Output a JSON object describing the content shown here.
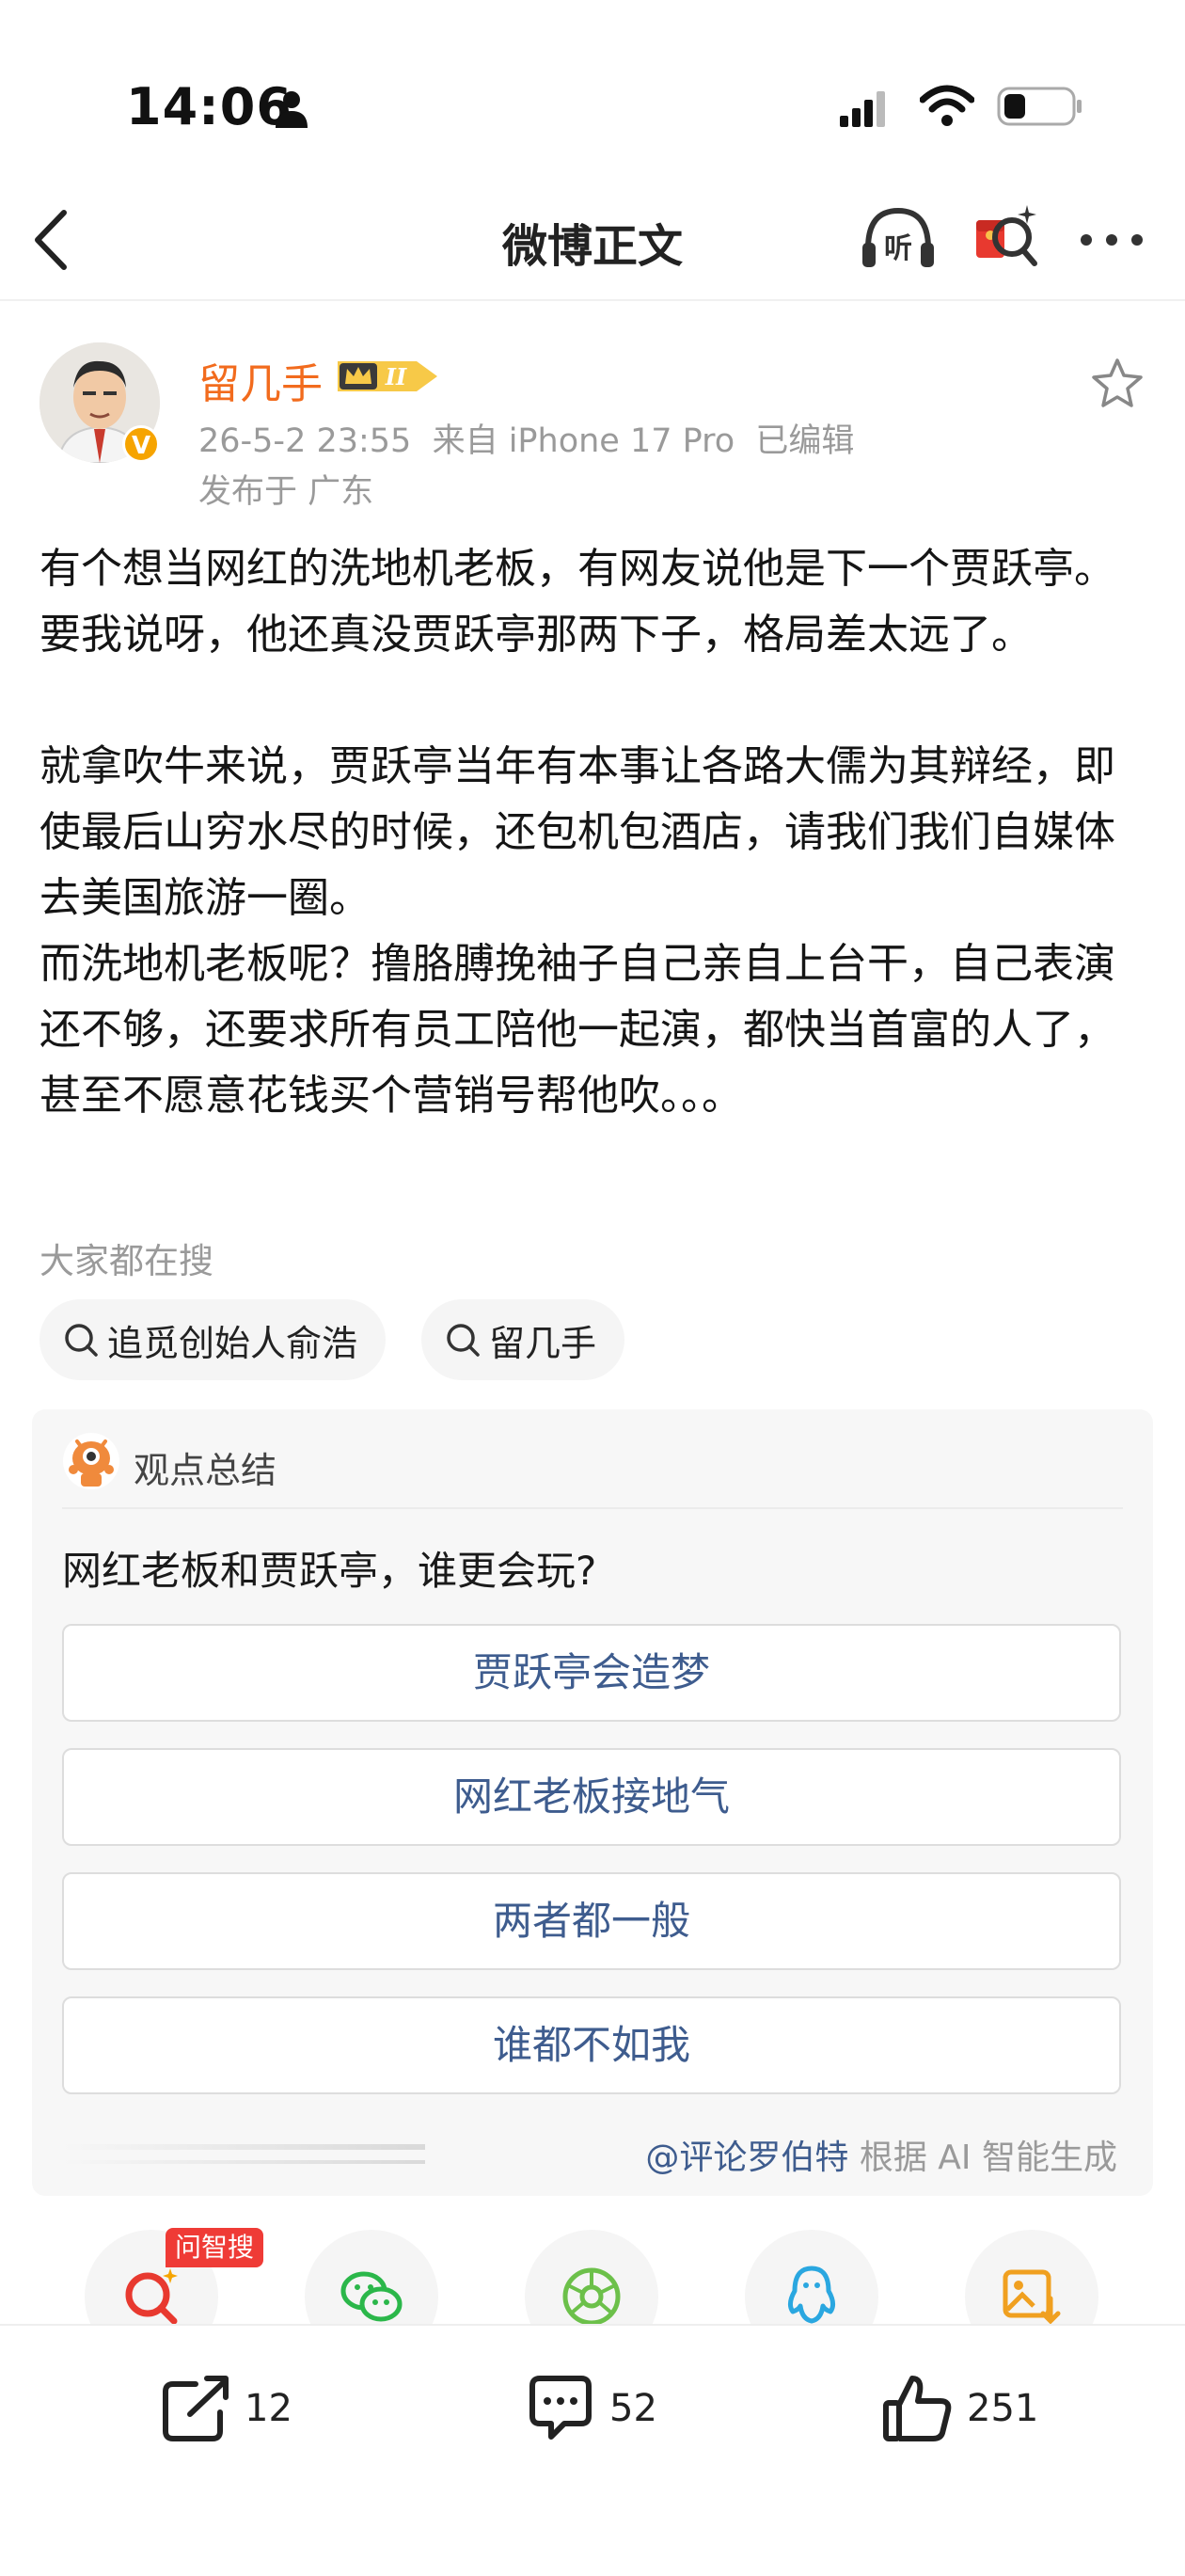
{
  "status_bar": {
    "time": "14:06"
  },
  "nav": {
    "title": "微博正文"
  },
  "author": {
    "name": "留几手",
    "verified_badge": "V",
    "meta_line": "26-5-2 23:55  来自 iPhone 17 Pro  已编辑",
    "location_line": "发布于 广东"
  },
  "post": {
    "text": "有个想当网红的洗地机老板，有网友说他是下一个贾跃亭。\n要我说呀，他还真没贾跃亭那两下子，格局差太远了。\n\n就拿吹牛来说，贾跃亭当年有本事让各路大儒为其辩经，即使最后山穷水尽的时候，还包机包酒店，请我们我们自媒体去美国旅游一圈。\n而洗地机老板呢？撸胳膊挽袖子自己亲自上台干，自己表演还不够，还要求所有员工陪他一起演，都快当首富的人了，甚至不愿意花钱买个营销号帮他吹。。。"
  },
  "hot_search": {
    "label": "大家都在搜",
    "chips": [
      "追觅创始人俞浩",
      "留几手"
    ]
  },
  "summary_card": {
    "header": "观点总结",
    "question": "网红老板和贾跃亭，谁更会玩?",
    "options": [
      "贾跃亭会造梦",
      "网红老板接地气",
      "两者都一般",
      "谁都不如我"
    ],
    "credit_handle": "@评论罗伯特",
    "credit_note": " 根据 AI 智能生成"
  },
  "share_row": {
    "tag": "问智搜",
    "icons": [
      "ask-search-icon",
      "wechat-icon",
      "moments-icon",
      "qq-icon",
      "save-image-icon"
    ]
  },
  "actions": {
    "repost_count": "12",
    "comment_count": "52",
    "like_count": "251"
  },
  "colors": {
    "author_orange": "#f26b1d",
    "link_blue": "#3e5c8e",
    "tag_red": "#ef3b36"
  }
}
